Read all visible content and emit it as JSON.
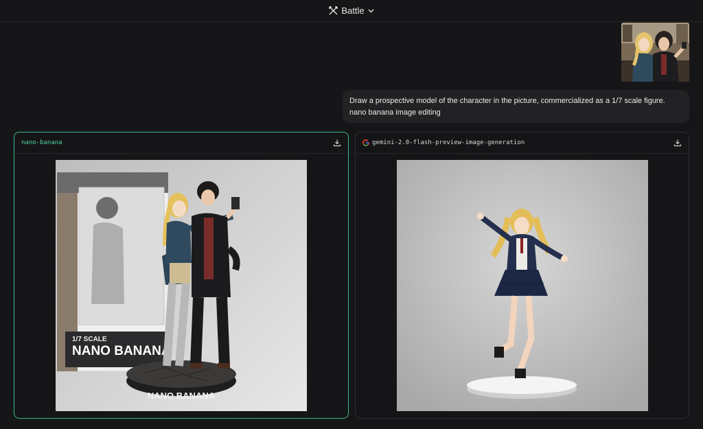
{
  "header": {
    "mode_label": "Battle",
    "mode_icon": "battle-swords-icon",
    "dropdown_icon": "chevron-down-icon"
  },
  "prompt": {
    "line1": "Draw a prospective model of the character in the picture, commercialized as a 1/7 scale figure.",
    "line2": "nano banana image editing"
  },
  "responses": [
    {
      "model": "nano-banana",
      "download_icon": "download-icon",
      "box_scale": "1/7 SCALE",
      "box_title": "NANO BANANA",
      "base_text": "NANO BANANA",
      "selected_accent": "#3cb98f"
    },
    {
      "model": "gemini-2.0-flash-preview-image-generation",
      "provider_icon": "google-g-icon",
      "download_icon": "download-icon"
    }
  ]
}
